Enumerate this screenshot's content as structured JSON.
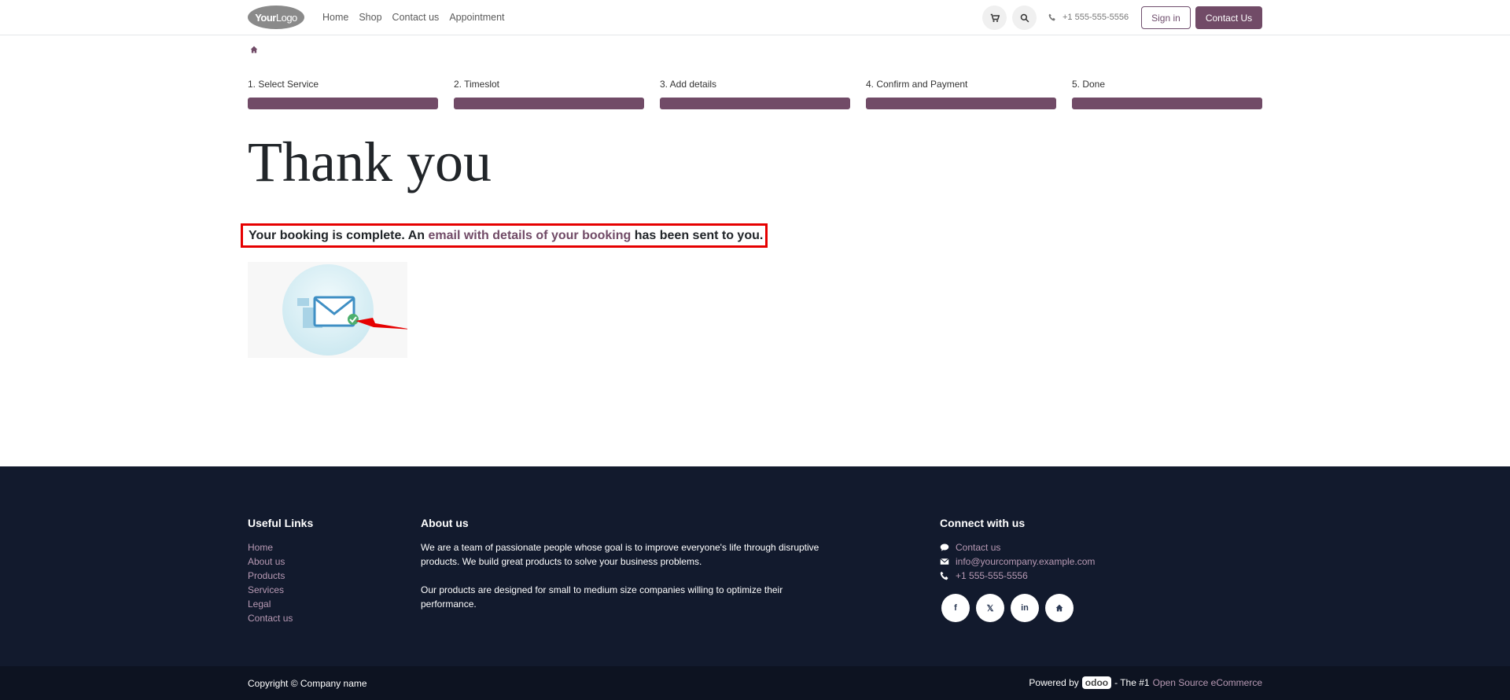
{
  "header": {
    "logo_bold": "Your",
    "logo_light": "Logo",
    "nav": [
      "Home",
      "Shop",
      "Contact us",
      "Appointment"
    ],
    "phone": "+1 555-555-5556",
    "sign_in": "Sign in",
    "contact_us": "Contact Us"
  },
  "steps": [
    "1. Select Service",
    "2. Timeslot",
    "3. Add details",
    "4. Confirm and Payment",
    "5. Done"
  ],
  "main": {
    "title": "Thank you",
    "msg_before": "Your booking is complete. An ",
    "msg_link": "email with details of your booking",
    "msg_after": " has been sent to you."
  },
  "footer": {
    "useful_links_title": "Useful Links",
    "useful_links": [
      "Home",
      "About us",
      "Products",
      "Services",
      "Legal",
      "Contact us"
    ],
    "about_title": "About us",
    "about_p1": "We are a team of passionate people whose goal is to improve everyone's life through disruptive products. We build great products to solve your business problems.",
    "about_p2": "Our products are designed for small to medium size companies willing to optimize their performance.",
    "connect_title": "Connect with us",
    "connect_contact": "Contact us",
    "connect_email": "info@yourcompany.example.com",
    "connect_phone": "+1 555-555-5556"
  },
  "copyright": {
    "text": "Copyright © Company name",
    "powered_by": "Powered by",
    "odoo": "odoo",
    "tagline": "- The #1",
    "tagline_link": "Open Source eCommerce"
  },
  "colors": {
    "brand": "#714b67",
    "footer_bg": "#121a2d",
    "highlight": "#e60000"
  }
}
